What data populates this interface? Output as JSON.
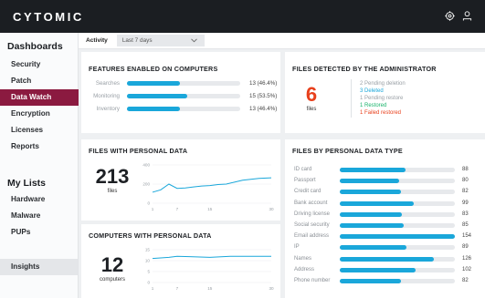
{
  "app": {
    "logo": "CYTOMIC",
    "accent": "#8b1a40",
    "bar_color": "#1aa7da"
  },
  "top_icons": [
    "settings-icon",
    "user-icon"
  ],
  "sidebar": {
    "dashboards_heading": "Dashboards",
    "items": [
      {
        "label": "Security"
      },
      {
        "label": "Patch"
      },
      {
        "label": "Data Watch",
        "active": true
      },
      {
        "label": "Encryption"
      },
      {
        "label": "Licenses"
      },
      {
        "label": "Reports"
      }
    ],
    "mylists_heading": "My Lists",
    "list_items": [
      {
        "label": "Hardware"
      },
      {
        "label": "Malware"
      },
      {
        "label": "PUPs"
      }
    ],
    "insights_label": "Insights"
  },
  "filter": {
    "label": "Activity",
    "value": "Last 7 days"
  },
  "features_card": {
    "title": "FEATURES ENABLED ON COMPUTERS",
    "rows": [
      {
        "label": "Searches",
        "fraction": 0.464,
        "value": "13 (46.4%)"
      },
      {
        "label": "Monitoring",
        "fraction": 0.535,
        "value": "15 (53.5%)"
      },
      {
        "label": "Inventory",
        "fraction": 0.464,
        "value": "13 (46.4%)"
      }
    ]
  },
  "admin_card": {
    "title": "FILES DETECTED BY THE ADMINISTRATOR",
    "number": "6",
    "number_color": "#e8401c",
    "unit": "files",
    "lines": [
      {
        "text": "2 Pending deletion",
        "color": "#9aa0a6"
      },
      {
        "text": "3 Deleted",
        "color": "#1aa7da"
      },
      {
        "text": "1 Pending restore",
        "color": "#9aa0a6"
      },
      {
        "text": "1 Restored",
        "color": "#19b36b"
      },
      {
        "text": "1 Failed restored",
        "color": "#e8401c"
      }
    ]
  },
  "files_pd_card": {
    "title": "FILES WITH PERSONAL DATA",
    "number": "213",
    "unit": "files",
    "chart_data": {
      "type": "line",
      "x_ticks": [
        "1",
        "7",
        "15",
        "30"
      ],
      "y_ticks": [
        "400",
        "200",
        "0"
      ],
      "ylim": [
        0,
        400
      ],
      "x": [
        1,
        3,
        5,
        7,
        9,
        11,
        13,
        15,
        17,
        19,
        21,
        23,
        25,
        27,
        30
      ],
      "values": [
        115,
        140,
        200,
        155,
        160,
        170,
        180,
        185,
        195,
        200,
        220,
        240,
        250,
        260,
        265
      ]
    }
  },
  "computers_pd_card": {
    "title": "COMPUTERS WITH PERSONAL DATA",
    "number": "12",
    "unit": "computers",
    "chart_data": {
      "type": "line",
      "x_ticks": [
        "1",
        "7",
        "15",
        "30"
      ],
      "y_ticks": [
        "15",
        "10",
        "5",
        "0"
      ],
      "ylim": [
        0,
        15
      ],
      "x": [
        1,
        5,
        7,
        10,
        15,
        20,
        25,
        30
      ],
      "values": [
        11,
        11.5,
        12,
        11.8,
        11.5,
        12,
        12,
        12
      ]
    }
  },
  "type_card": {
    "title": "FILES BY PERSONAL DATA TYPE",
    "max": 154,
    "rows": [
      {
        "label": "ID card",
        "value": "88"
      },
      {
        "label": "Passport",
        "value": "80"
      },
      {
        "label": "Credit card",
        "value": "82"
      },
      {
        "label": "Bank account",
        "value": "99"
      },
      {
        "label": "Driving license",
        "value": "83"
      },
      {
        "label": "Social security",
        "value": "85"
      },
      {
        "label": "Email address",
        "value": "154"
      },
      {
        "label": "IP",
        "value": "89"
      },
      {
        "label": "Names",
        "value": "126"
      },
      {
        "label": "Address",
        "value": "102"
      },
      {
        "label": "Phone number",
        "value": "82"
      }
    ]
  }
}
